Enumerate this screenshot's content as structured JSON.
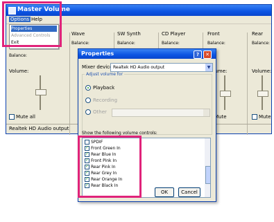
{
  "main": {
    "title": "Master Volume",
    "menu": {
      "options": "Options",
      "help": "Help"
    },
    "dropdown": [
      "Properties",
      "Advanced Controls",
      "Exit"
    ],
    "columns": [
      {
        "name": "Wave",
        "balance": "Balance:"
      },
      {
        "name": "SW Synth",
        "balance": "Balance:"
      },
      {
        "name": "CD Player",
        "balance": "Balance:"
      },
      {
        "name": "Front",
        "balance": "Balance:"
      },
      {
        "name": "Rear",
        "balance": "Balance:"
      }
    ],
    "master_balance": "Balance:",
    "volume_label": "Volume:",
    "mute_all": "Mute all",
    "mute": "Mute",
    "status": "Realtek HD Audio output"
  },
  "dialog": {
    "title": "Properties",
    "mixer_label": "Mixer device:",
    "mixer_value": "Realtek HD Audio output",
    "adjust_label": "Adjust volume for",
    "radio_playback": "Playback",
    "radio_recording": "Recording",
    "radio_other": "Other",
    "show_label": "Show the following volume controls:",
    "list": [
      {
        "label": "SPDIF",
        "checked": false
      },
      {
        "label": "Front Green In",
        "checked": true
      },
      {
        "label": "Rear Blue In",
        "checked": true
      },
      {
        "label": "Front Pink In",
        "checked": true
      },
      {
        "label": "Rear Pink In",
        "checked": true
      },
      {
        "label": "Rear Grey In",
        "checked": true
      },
      {
        "label": "Rear Orange In",
        "checked": true
      },
      {
        "label": "Rear Black In",
        "checked": true
      }
    ],
    "ok": "OK",
    "cancel": "Cancel"
  },
  "colors": {
    "highlight": "#e0237a",
    "titlebar": "#0b54e3"
  }
}
